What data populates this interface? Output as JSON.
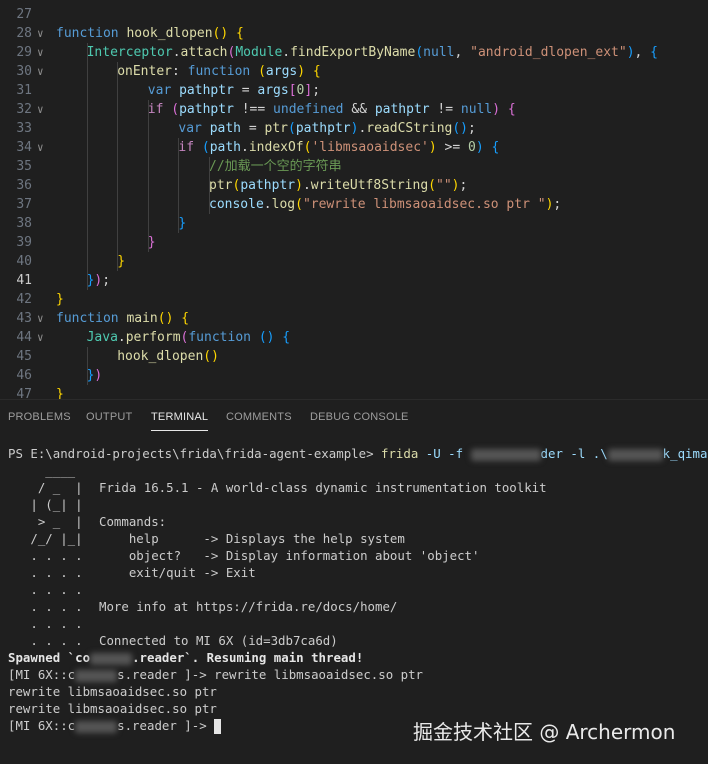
{
  "editor": {
    "lines": [
      {
        "n": "27"
      },
      {
        "n": "28",
        "fold": true,
        "tokens": [
          [
            "kw",
            "function "
          ],
          [
            "fn",
            "hook_dlopen"
          ],
          [
            "p1",
            "() {"
          ]
        ]
      },
      {
        "n": "29",
        "fold": true,
        "tokens": [
          [
            "cls",
            "Interceptor"
          ],
          [
            "op",
            "."
          ],
          [
            "fn",
            "attach"
          ],
          [
            "p2",
            "("
          ],
          [
            "cls",
            "Module"
          ],
          [
            "op",
            "."
          ],
          [
            "fn",
            "findExportByName"
          ],
          [
            "p3",
            "("
          ],
          [
            "kw",
            "null"
          ],
          [
            "op",
            ", "
          ],
          [
            "str",
            "\"android_dlopen_ext\""
          ],
          [
            "p3",
            ")"
          ],
          [
            "op",
            ", "
          ],
          [
            "p3",
            "{"
          ]
        ]
      },
      {
        "n": "30",
        "fold": true,
        "tokens": [
          [
            "fn",
            "onEnter"
          ],
          [
            "op",
            ": "
          ],
          [
            "kw",
            "function "
          ],
          [
            "p1",
            "("
          ],
          [
            "var",
            "args"
          ],
          [
            "p1",
            ") {"
          ]
        ]
      },
      {
        "n": "31",
        "tokens": [
          [
            "kw",
            "var "
          ],
          [
            "var",
            "pathptr"
          ],
          [
            "op",
            " = "
          ],
          [
            "var",
            "args"
          ],
          [
            "p2",
            "["
          ],
          [
            "num",
            "0"
          ],
          [
            "p2",
            "]"
          ],
          [
            "op",
            ";"
          ]
        ]
      },
      {
        "n": "32",
        "fold": true,
        "tokens": [
          [
            "ctl",
            "if "
          ],
          [
            "p2",
            "("
          ],
          [
            "var",
            "pathptr"
          ],
          [
            "op",
            " !== "
          ],
          [
            "kw",
            "undefined"
          ],
          [
            "op",
            " && "
          ],
          [
            "var",
            "pathptr"
          ],
          [
            "op",
            " != "
          ],
          [
            "kw",
            "null"
          ],
          [
            "p2",
            ")"
          ],
          [
            "p2",
            " {"
          ]
        ]
      },
      {
        "n": "33",
        "tokens": [
          [
            "kw",
            "var "
          ],
          [
            "var",
            "path"
          ],
          [
            "op",
            " = "
          ],
          [
            "fn",
            "ptr"
          ],
          [
            "p3",
            "("
          ],
          [
            "var",
            "pathptr"
          ],
          [
            "p3",
            ")"
          ],
          [
            "op",
            "."
          ],
          [
            "fn",
            "readCString"
          ],
          [
            "p3",
            "()"
          ],
          [
            "op",
            ";"
          ]
        ]
      },
      {
        "n": "34",
        "fold": true,
        "tokens": [
          [
            "ctl",
            "if "
          ],
          [
            "p3",
            "("
          ],
          [
            "var",
            "path"
          ],
          [
            "op",
            "."
          ],
          [
            "fn",
            "indexOf"
          ],
          [
            "p1",
            "("
          ],
          [
            "str",
            "'libmsaoaidsec'"
          ],
          [
            "p1",
            ")"
          ],
          [
            "op",
            " >= "
          ],
          [
            "num",
            "0"
          ],
          [
            "p3",
            ")"
          ],
          [
            "p3",
            " {"
          ]
        ]
      },
      {
        "n": "35",
        "tokens": [
          [
            "com",
            "//加载一个空的字符串"
          ]
        ]
      },
      {
        "n": "36",
        "tokens": [
          [
            "fn",
            "ptr"
          ],
          [
            "p1",
            "("
          ],
          [
            "var",
            "pathptr"
          ],
          [
            "p1",
            ")"
          ],
          [
            "op",
            "."
          ],
          [
            "fn",
            "writeUtf8String"
          ],
          [
            "p1",
            "("
          ],
          [
            "str",
            "\"\""
          ],
          [
            "p1",
            ")"
          ],
          [
            "op",
            ";"
          ]
        ]
      },
      {
        "n": "37",
        "tokens": [
          [
            "var",
            "console"
          ],
          [
            "op",
            "."
          ],
          [
            "fn",
            "log"
          ],
          [
            "p1",
            "("
          ],
          [
            "str",
            "\"rewrite libmsaoaidsec.so ptr \""
          ],
          [
            "p1",
            ")"
          ],
          [
            "op",
            ";"
          ]
        ]
      },
      {
        "n": "38",
        "tokens": [
          [
            "p3",
            "}"
          ]
        ]
      },
      {
        "n": "39",
        "tokens": [
          [
            "p2",
            "}"
          ]
        ]
      },
      {
        "n": "40",
        "tokens": [
          [
            "p1",
            "}"
          ]
        ]
      },
      {
        "n": "41",
        "active": true,
        "tokens": [
          [
            "p3",
            "}"
          ],
          [
            "p2",
            ")"
          ],
          [
            "op",
            ";"
          ]
        ]
      },
      {
        "n": "42",
        "tokens": [
          [
            "p1",
            "}"
          ]
        ]
      },
      {
        "n": "43",
        "fold": true,
        "tokens": [
          [
            "kw",
            "function "
          ],
          [
            "fn",
            "main"
          ],
          [
            "p1",
            "() {"
          ]
        ]
      },
      {
        "n": "44",
        "fold": true,
        "tokens": [
          [
            "cls",
            "Java"
          ],
          [
            "op",
            "."
          ],
          [
            "fn",
            "perform"
          ],
          [
            "p2",
            "("
          ],
          [
            "kw",
            "function "
          ],
          [
            "p3",
            "() {"
          ]
        ]
      },
      {
        "n": "45",
        "tokens": [
          [
            "fn",
            "hook_dlopen"
          ],
          [
            "p1",
            "()"
          ]
        ]
      },
      {
        "n": "46",
        "tokens": [
          [
            "p3",
            "}"
          ],
          [
            "p2",
            ")"
          ]
        ]
      },
      {
        "n": "47",
        "tokens": [
          [
            "p1",
            "}"
          ]
        ]
      }
    ]
  },
  "panel": {
    "tabs": [
      "PROBLEMS",
      "OUTPUT",
      "TERMINAL",
      "COMMENTS",
      "DEBUG CONSOLE"
    ],
    "active_tab": "TERMINAL"
  },
  "terminal": {
    "prompt": "PS E:\\android-projects\\frida\\frida-agent-example>",
    "command": "frida",
    "command_args_1": " -U -f ",
    "command_args_2": "der -l .\\",
    "command_args_3": "k_qimao_",
    "logo": [
      "     ____",
      "    / _  |",
      "   | (_| |",
      "    > _  |",
      "   /_/ |_|",
      "   . . . .",
      "   . . . .",
      "   . . . .",
      "   . . . .",
      "   . . . .",
      "   . . . ."
    ],
    "info": {
      "l1": "Frida 16.5.1 - A world-class dynamic instrumentation toolkit",
      "l3": "Commands:",
      "l4": "    help      -> Displays the help system",
      "l5": "    object?   -> Display information about 'object'",
      "l6": "    exit/quit -> Exit",
      "l9": "More info at https://frida.re/docs/home/",
      "l11": "Connected to MI 6X (id=3db7ca6d)"
    },
    "spawned_pre": "Spawned `co",
    "spawned_post": ".reader`. Resuming main thread!",
    "out1": "[MI 6X::com.xx.reader ]-> rewrite libmsaoaidsec.so ptr",
    "out1_pre": "[MI 6X::c",
    "out1_post": "s.reader ]-> rewrite libmsaoaidsec.so ptr",
    "out2": "rewrite libmsaoaidsec.so ptr",
    "out3": "rewrite libmsaoaidsec.so ptr",
    "prompt2_pre": "[MI 6X::c",
    "prompt2_post": "s.reader ]-> "
  },
  "watermark": "掘金技术社区 @ Archermon"
}
